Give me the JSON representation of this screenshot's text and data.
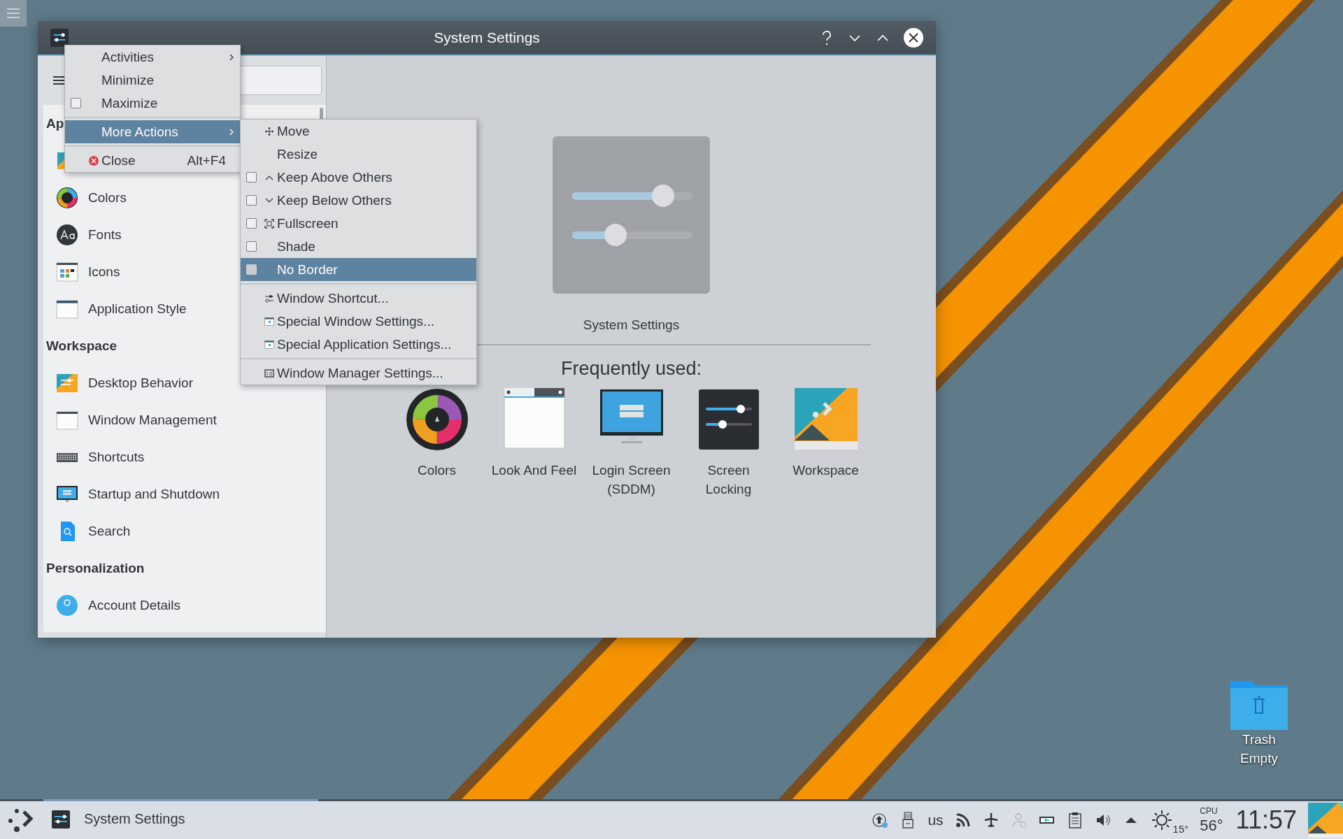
{
  "window": {
    "title": "System Settings"
  },
  "sidebar": {
    "sections": [
      {
        "heading": "Ap"
      },
      {
        "heading": "Workspace",
        "items": [
          {
            "label": "Desktop Behavior"
          },
          {
            "label": "Window Management"
          },
          {
            "label": "Shortcuts"
          },
          {
            "label": "Startup and Shutdown"
          },
          {
            "label": "Search"
          }
        ]
      },
      {
        "heading": "Personalization",
        "items": [
          {
            "label": "Account Details"
          }
        ]
      }
    ],
    "appearance_items": [
      {
        "label": "Colors"
      },
      {
        "label": "Fonts"
      },
      {
        "label": "Icons"
      },
      {
        "label": "Application Style"
      }
    ]
  },
  "main": {
    "title": "System Settings",
    "frequent_heading": "Frequently used:",
    "frequent": [
      {
        "label": "Colors"
      },
      {
        "label": "Look And Feel"
      },
      {
        "label": "Login Screen (SDDM)"
      },
      {
        "label": "Screen Locking"
      },
      {
        "label": "Workspace"
      }
    ]
  },
  "window_menu": [
    {
      "kind": "submenu",
      "label": "Activities",
      "selected": false
    },
    {
      "kind": "action",
      "label": "Minimize",
      "selected": false
    },
    {
      "kind": "checkbox",
      "label": "Maximize",
      "checked": false,
      "selected": false
    },
    {
      "kind": "separator"
    },
    {
      "kind": "submenu",
      "label": "More Actions",
      "selected": true
    },
    {
      "kind": "separator"
    },
    {
      "kind": "action",
      "label": "Close",
      "shortcut": "Alt+F4",
      "selected": false
    }
  ],
  "more_actions_menu": [
    {
      "kind": "action",
      "label": "Move",
      "selected": false
    },
    {
      "kind": "action",
      "label": "Resize",
      "selected": false
    },
    {
      "kind": "checkbox",
      "label": "Keep Above Others",
      "checked": false,
      "selected": false
    },
    {
      "kind": "checkbox",
      "label": "Keep Below Others",
      "checked": false,
      "selected": false
    },
    {
      "kind": "checkbox",
      "label": "Fullscreen",
      "checked": false,
      "selected": false
    },
    {
      "kind": "checkbox",
      "label": "Shade",
      "checked": false,
      "selected": false
    },
    {
      "kind": "checkbox",
      "label": "No Border",
      "checked": false,
      "selected": true
    },
    {
      "kind": "separator"
    },
    {
      "kind": "action",
      "label": "Window Shortcut...",
      "selected": false
    },
    {
      "kind": "action",
      "label": "Special Window Settings...",
      "selected": false
    },
    {
      "kind": "action",
      "label": "Special Application Settings...",
      "selected": false
    },
    {
      "kind": "separator"
    },
    {
      "kind": "action",
      "label": "Window Manager Settings...",
      "selected": false
    }
  ],
  "desktop_icons": [
    {
      "label": "Trash",
      "sublabel": "Empty"
    }
  ],
  "taskbar": {
    "task": "System Settings",
    "keyboard_layout": "us",
    "weather": "15°",
    "cpu_label": "CPU",
    "cpu_temp": "56°",
    "clock": "11:57"
  }
}
